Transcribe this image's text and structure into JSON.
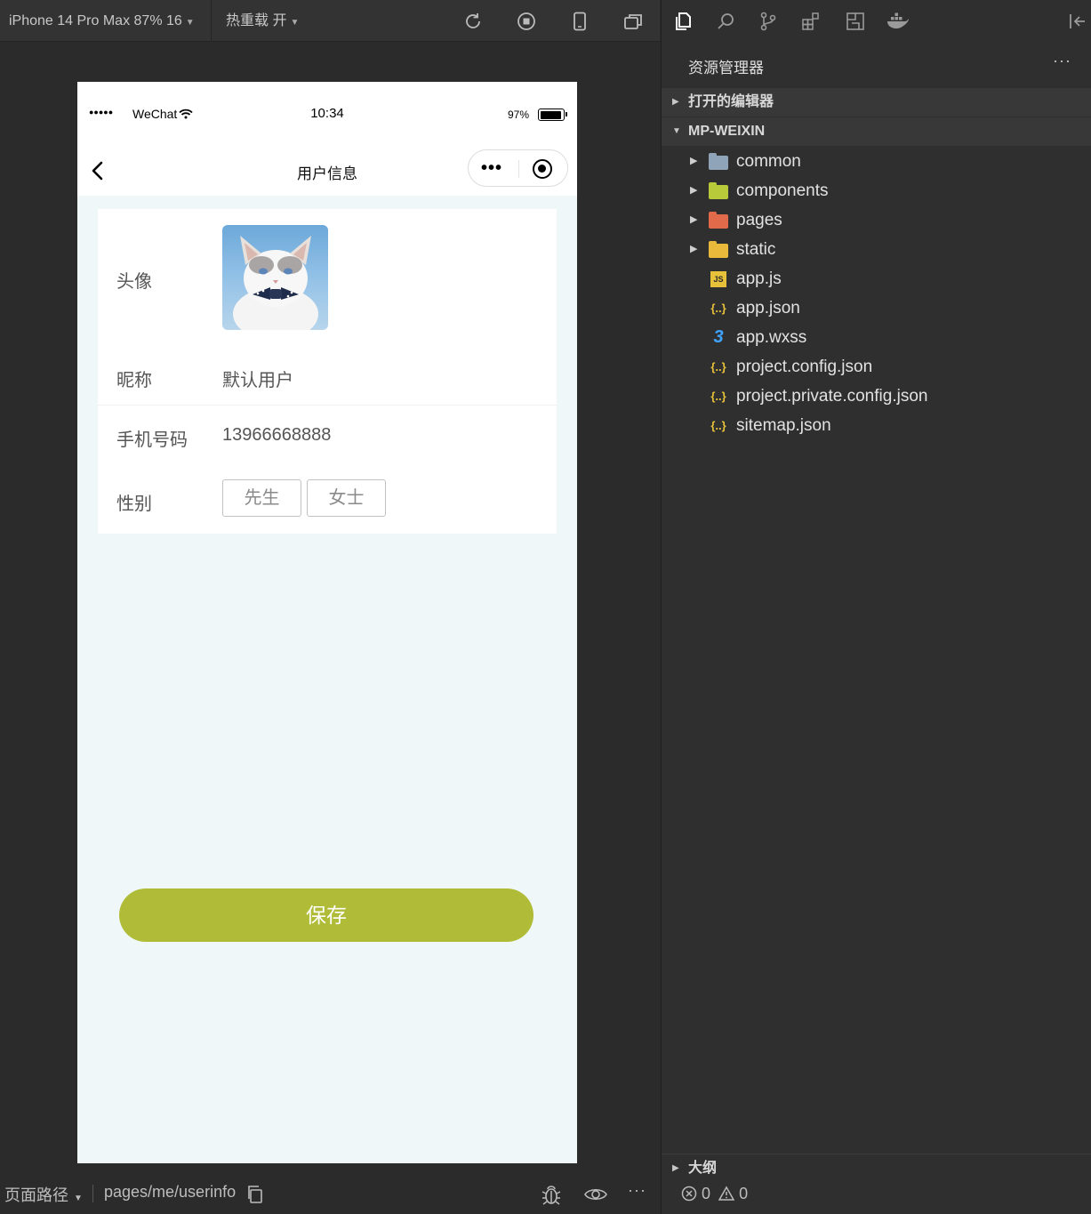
{
  "simulator": {
    "device_label": "iPhone 14 Pro Max 87% 16",
    "hot_reload_label": "热重载 开",
    "status_bar": {
      "signal": "●●●●●",
      "carrier": "WeChat",
      "time": "10:34",
      "battery_pct": "97%"
    },
    "nav": {
      "title": "用户信息",
      "more_glyph": "•••"
    },
    "form": {
      "avatar_label": "头像",
      "nickname_label": "昵称",
      "nickname_value": "默认用户",
      "phone_label": "手机号码",
      "phone_value": "13966668888",
      "gender_label": "性别",
      "gender_options": [
        "先生",
        "女士"
      ]
    },
    "save_label": "保存",
    "bottom_bar": {
      "path_label": "页面路径",
      "path_value": "pages/me/userinfo",
      "more": "···"
    }
  },
  "explorer": {
    "header": "资源管理器",
    "more": "···",
    "open_editors": "打开的编辑器",
    "project": "MP-WEIXIN",
    "tree": [
      {
        "name": "common",
        "type": "folder",
        "color": "#8fa4b8"
      },
      {
        "name": "components",
        "type": "folder",
        "color": "#b8c93a"
      },
      {
        "name": "pages",
        "type": "folder",
        "color": "#e06a4a"
      },
      {
        "name": "static",
        "type": "folder",
        "color": "#e8b93a"
      },
      {
        "name": "app.js",
        "type": "js"
      },
      {
        "name": "app.json",
        "type": "json"
      },
      {
        "name": "app.wxss",
        "type": "css"
      },
      {
        "name": "project.config.json",
        "type": "json"
      },
      {
        "name": "project.private.config.json",
        "type": "json"
      },
      {
        "name": "sitemap.json",
        "type": "json"
      }
    ],
    "outline": "大纲",
    "problems": {
      "errors": "0",
      "warnings": "0"
    }
  },
  "colors": {
    "accent": "#b0bb37",
    "page_bg": "#eff7f8",
    "ide_bg": "#2b2b2b"
  }
}
